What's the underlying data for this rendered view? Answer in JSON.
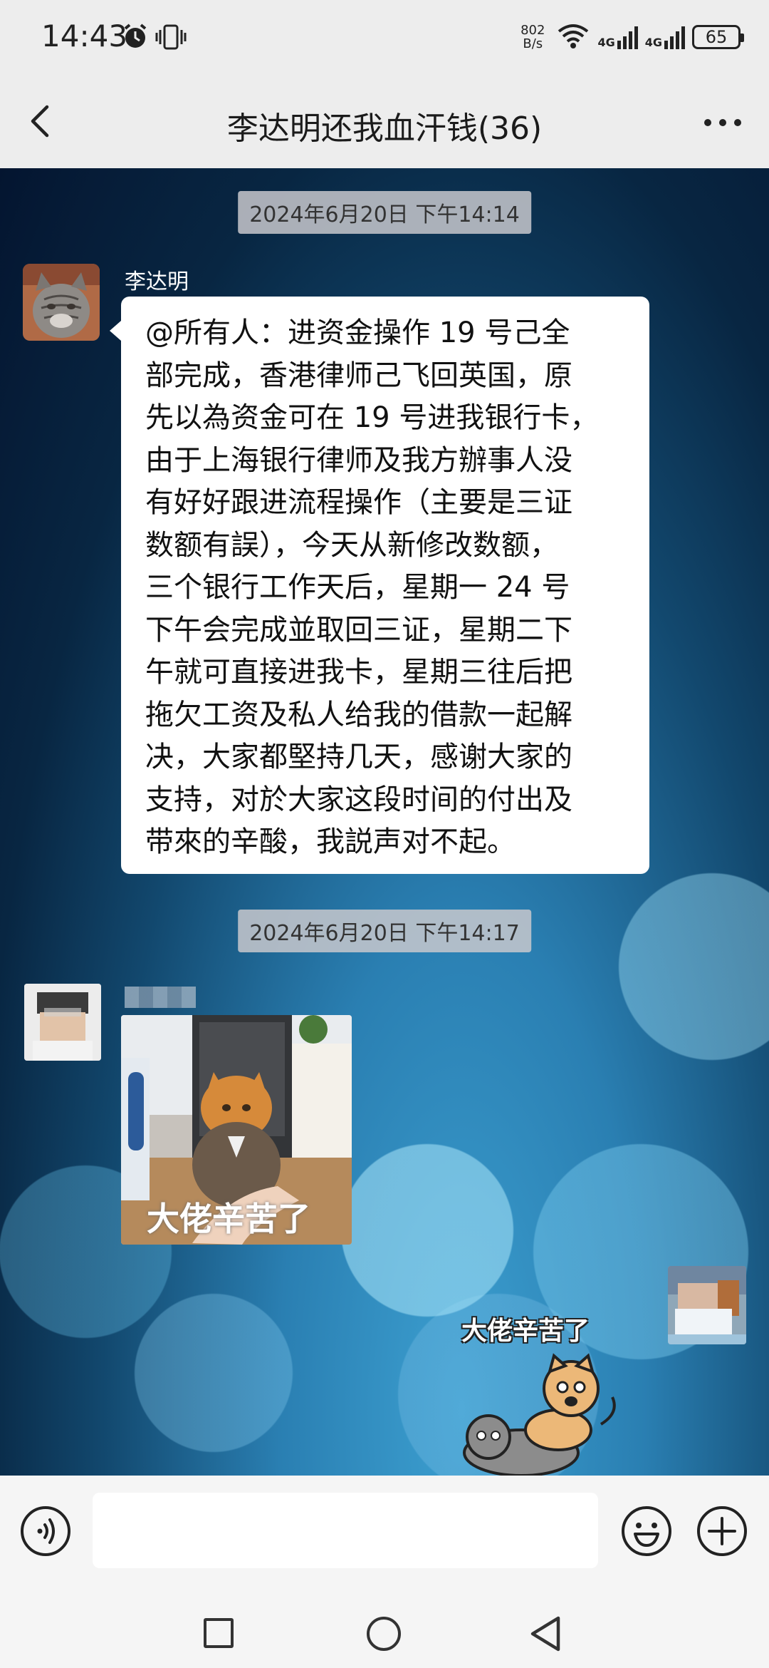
{
  "status_bar": {
    "time": "14:43",
    "net_speed_value": "802",
    "net_speed_unit": "B/s",
    "signal1_label": "4G",
    "signal2_label": "4G",
    "battery": "65"
  },
  "nav": {
    "title": "李达明还我血汗钱(36)"
  },
  "messages": {
    "timestamp1": "2024年6月20日 下午14:14",
    "msg1": {
      "sender": "李达明",
      "text": "@所有人：进资金操作 19 号己全\n部完成，香港律师己飞回英国，原\n先以為资金可在 19 号进我银行卡，\n由于上海银行律师及我方辦事人没\n有好好跟进流程操作（主要是三证\n数额有誤），今天从新修改数额，\n三个银行工作天后，星期一 24 号\n下午会完成並取回三证，星期二下\n午就可直接进我卡，星期三往后把\n拖欠工资及私人给我的借款一起解\n决，大家都堅持几天，感谢大家的\n支持，对於大家这段时间的付出及\n带來的辛酸，我説声对不起。"
    },
    "timestamp2": "2024年6月20日 下午14:17",
    "msg2": {
      "image_caption": "大佬辛苦了"
    },
    "msg3": {
      "sticker_text": "大佬辛苦了"
    }
  },
  "input": {
    "placeholder": ""
  },
  "colors": {
    "bubble": "#ffffff",
    "background": "#ededed",
    "chat_bg_dark": "#041530",
    "chat_bg_light": "#3c9fd0"
  },
  "icons": {
    "back": "chevron-left-icon",
    "more": "more-dots-icon",
    "voice": "voice-icon",
    "emoji": "emoji-icon",
    "plus": "plus-icon"
  }
}
